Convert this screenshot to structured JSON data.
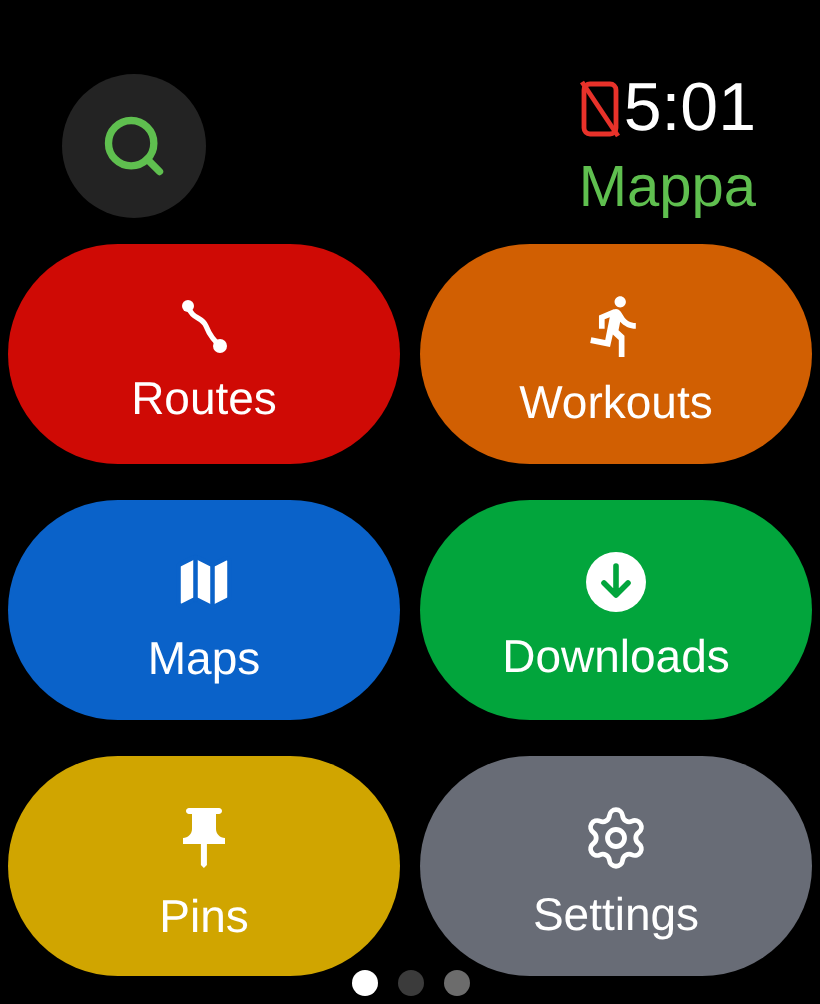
{
  "status": {
    "time": "5:01",
    "app_title": "Mappa"
  },
  "tiles": [
    {
      "kind": "routes",
      "label": "Routes",
      "color": "#cf0a05"
    },
    {
      "kind": "workouts",
      "label": "Workouts",
      "color": "#d15f02"
    },
    {
      "kind": "maps",
      "label": "Maps",
      "color": "#0a62c9"
    },
    {
      "kind": "downloads",
      "label": "Downloads",
      "color": "#02a53c"
    },
    {
      "kind": "pins",
      "label": "Pins",
      "color": "#d0a500"
    },
    {
      "kind": "settings",
      "label": "Settings",
      "color": "#686c76"
    }
  ],
  "page_dots": [
    {
      "selected": true
    },
    {
      "selected": false
    },
    {
      "selected": false
    }
  ]
}
